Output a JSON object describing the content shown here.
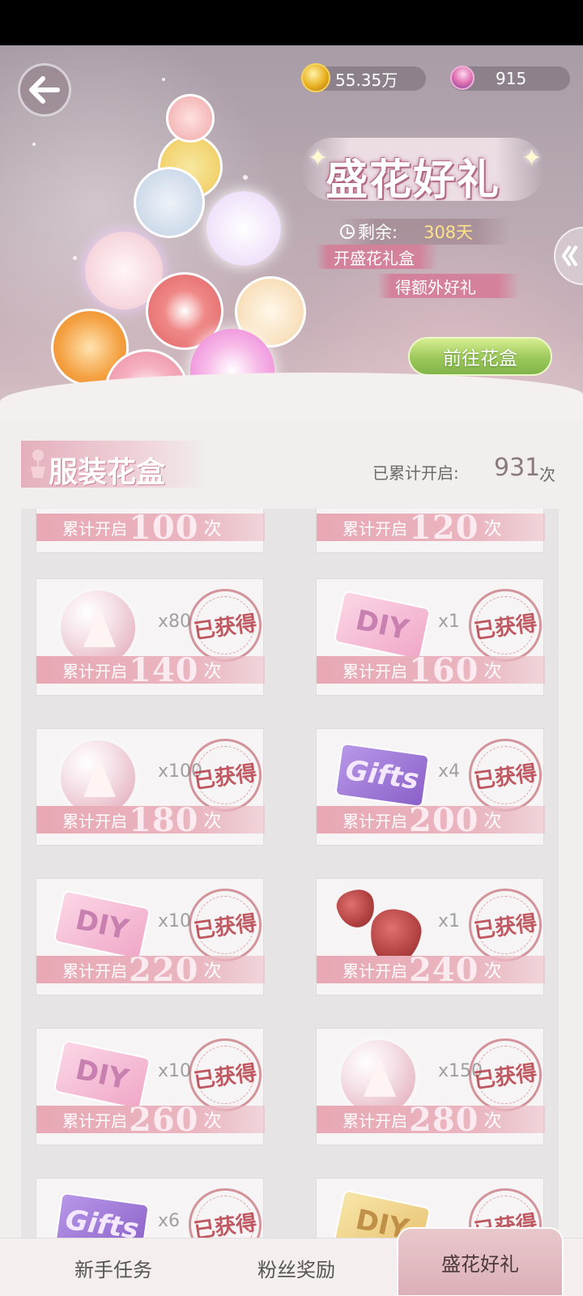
{
  "header": {
    "coins": "55.35万",
    "gems": "915",
    "event_title": "盛花好礼",
    "remaining_label": "剩余:",
    "remaining_days": "308天",
    "promo_line1": "开盛花礼盒",
    "promo_line2": "得额外好礼",
    "goto_label": "前往花盒"
  },
  "section": {
    "title": "服装花盒",
    "total_label": "已累计开启:",
    "total_count": "931",
    "total_unit": "次"
  },
  "rewards": [
    {
      "label": "累计开启",
      "count": "100",
      "unit": "次",
      "qty": "",
      "stamp": ""
    },
    {
      "label": "累计开启",
      "count": "120",
      "unit": "次",
      "qty": "",
      "stamp": ""
    },
    {
      "label": "累计开启",
      "count": "140",
      "unit": "次",
      "qty": "x80",
      "stamp": "已获得",
      "item": "dress-orb-icon"
    },
    {
      "label": "累计开启",
      "count": "160",
      "unit": "次",
      "qty": "x1",
      "stamp": "已获得",
      "item": "diy-ticket-icon"
    },
    {
      "label": "累计开启",
      "count": "180",
      "unit": "次",
      "qty": "x100",
      "stamp": "已获得",
      "item": "dress-orb-icon"
    },
    {
      "label": "累计开启",
      "count": "200",
      "unit": "次",
      "qty": "x4",
      "stamp": "已获得",
      "item": "gift-ticket-icon"
    },
    {
      "label": "累计开启",
      "count": "220",
      "unit": "次",
      "qty": "x10",
      "stamp": "已获得",
      "item": "diy-ticket-icon"
    },
    {
      "label": "累计开启",
      "count": "240",
      "unit": "次",
      "qty": "x1",
      "stamp": "已获得",
      "item": "strawberry-icon"
    },
    {
      "label": "累计开启",
      "count": "260",
      "unit": "次",
      "qty": "x10",
      "stamp": "已获得",
      "item": "diy-ticket-icon"
    },
    {
      "label": "累计开启",
      "count": "280",
      "unit": "次",
      "qty": "x150",
      "stamp": "已获得",
      "item": "dress-orb-icon"
    },
    {
      "label": "",
      "count": "",
      "unit": "",
      "qty": "x6",
      "stamp": "已获得",
      "item": "gift-ticket-icon"
    },
    {
      "label": "",
      "count": "",
      "unit": "",
      "qty": "",
      "stamp": "已获得",
      "item": "gold-diy-ticket-icon"
    }
  ],
  "nav": {
    "tab1": "新手任务",
    "tab2": "粉丝奖励",
    "tab3": "盛花好礼"
  },
  "ticket_text": {
    "diy": "DIY",
    "gift": "Gifts"
  },
  "colors": {
    "accent_pink": "#e8a8b4",
    "stamp_red": "#b43c46",
    "goto_green": "#9cc85a"
  }
}
